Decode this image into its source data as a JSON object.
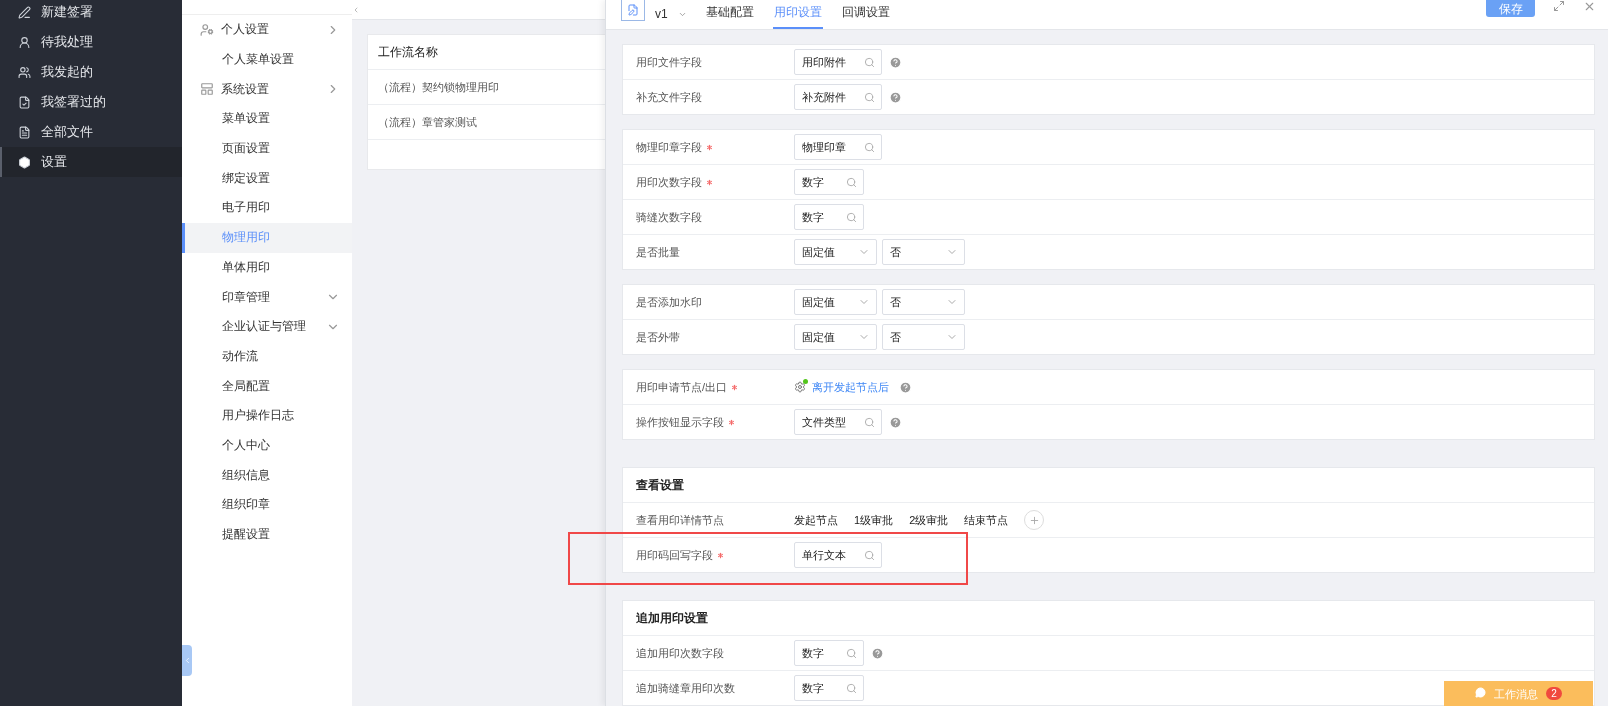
{
  "sidebar": {
    "items": [
      {
        "label": "新建签署",
        "selected": false,
        "kind": "new"
      },
      {
        "label": "待我处理",
        "selected": false,
        "kind": "todo"
      },
      {
        "label": "我发起的",
        "selected": false,
        "kind": "started"
      },
      {
        "label": "我签署过的",
        "selected": false,
        "kind": "signed"
      },
      {
        "label": "全部文件",
        "selected": false,
        "kind": "files"
      },
      {
        "label": "设置",
        "selected": true,
        "kind": "settings"
      }
    ]
  },
  "settings_menu": {
    "items": [
      {
        "label": "个人设置",
        "kind": "section",
        "selected": false
      },
      {
        "label": "个人菜单设置",
        "kind": "link",
        "selected": false
      },
      {
        "label": "系统设置",
        "kind": "section",
        "selected": false
      },
      {
        "label": "菜单设置",
        "kind": "link",
        "selected": false
      },
      {
        "label": "页面设置",
        "kind": "link",
        "selected": false
      },
      {
        "label": "绑定设置",
        "kind": "link",
        "selected": false
      },
      {
        "label": "电子用印",
        "kind": "link",
        "selected": false
      },
      {
        "label": "物理用印",
        "kind": "link",
        "selected": true
      },
      {
        "label": "单体用印",
        "kind": "link",
        "selected": false
      },
      {
        "label": "印章管理",
        "kind": "collapsible",
        "selected": false
      },
      {
        "label": "企业认证与管理",
        "kind": "collapsible",
        "selected": false
      },
      {
        "label": "动作流",
        "kind": "link",
        "selected": false
      },
      {
        "label": "全局配置",
        "kind": "link",
        "selected": false
      },
      {
        "label": "用户操作日志",
        "kind": "link",
        "selected": false
      },
      {
        "label": "个人中心",
        "kind": "link",
        "selected": false
      },
      {
        "label": "组织信息",
        "kind": "link",
        "selected": false
      },
      {
        "label": "组织印章",
        "kind": "link",
        "selected": false
      },
      {
        "label": "提醒设置",
        "kind": "link",
        "selected": false
      }
    ]
  },
  "workflow_table": {
    "columns": [
      "工作流名称"
    ],
    "rows": [
      {
        "name": "（流程）契约锁物理用印"
      },
      {
        "name": "（流程）章管家测试"
      }
    ]
  },
  "panel": {
    "version": "v1",
    "tabs": [
      {
        "label": "基础配置",
        "selected": false
      },
      {
        "label": "用印设置",
        "selected": true
      },
      {
        "label": "回调设置",
        "selected": false
      }
    ],
    "save_button": "保存",
    "cards": [
      {
        "rows": [
          {
            "label": "用印文件字段",
            "required": false,
            "kind": "lookup",
            "value": "用印附件",
            "help": true
          },
          {
            "label": "补充文件字段",
            "required": false,
            "kind": "lookup",
            "value": "补充附件",
            "help": true
          }
        ]
      },
      {
        "rows": [
          {
            "label": "物理印章字段",
            "required": true,
            "kind": "lookup",
            "value": "物理印章",
            "help": false
          },
          {
            "label": "用印次数字段",
            "required": true,
            "kind": "lookup_short",
            "value": "数字",
            "help": false
          },
          {
            "label": "骑缝次数字段",
            "required": false,
            "kind": "lookup_short",
            "value": "数字",
            "help": false
          },
          {
            "label": "是否批量",
            "required": false,
            "kind": "select_pair",
            "value": "固定值",
            "value_2": "否",
            "help": false
          }
        ]
      },
      {
        "rows": [
          {
            "label": "是否添加水印",
            "required": false,
            "kind": "select_pair",
            "value": "固定值",
            "value_2": "否",
            "help": false
          },
          {
            "label": "是否外带",
            "required": false,
            "kind": "select_pair",
            "value": "固定值",
            "value_2": "否",
            "help": false
          }
        ]
      },
      {
        "rows": [
          {
            "label": "用印申请节点/出口",
            "required": true,
            "kind": "node",
            "value": "离开发起节点后",
            "help": true
          },
          {
            "label": "操作按钮显示字段",
            "required": true,
            "kind": "lookup",
            "value": "文件类型",
            "help": true
          }
        ]
      },
      {
        "title": "查看设置",
        "rows": [
          {
            "label": "查看用印详情节点",
            "required": false,
            "kind": "tags",
            "tags": [
              "发起节点",
              "1级审批",
              "2级审批",
              "结束节点"
            ],
            "help": false
          },
          {
            "label": "用印码回写字段",
            "required": true,
            "kind": "lookup",
            "value": "单行文本",
            "help": false,
            "highlighted": true
          }
        ]
      },
      {
        "title": "追加用印设置",
        "rows": [
          {
            "label": "追加用印次数字段",
            "required": false,
            "kind": "lookup_short",
            "value": "数字",
            "help": true
          },
          {
            "label": "追加骑缝章用印次数",
            "required": false,
            "kind": "lookup_short",
            "value": "数字",
            "help": false
          }
        ]
      }
    ]
  },
  "work_message": {
    "label": "工作消息",
    "count": "2"
  }
}
